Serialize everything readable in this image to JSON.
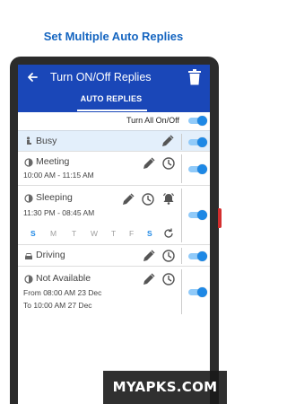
{
  "promo": {
    "title": "Set Multiple Auto Replies"
  },
  "appbar": {
    "title": "Turn ON/Off Replies"
  },
  "tabs": [
    {
      "label": "AUTO REPLIES"
    }
  ],
  "toggle_all": {
    "label": "Turn All On/Off",
    "on": true
  },
  "rows": [
    {
      "title": "Busy",
      "on": true,
      "selected": true
    },
    {
      "title": "Meeting",
      "time": "10:00 AM - 11:15 AM",
      "on": true
    },
    {
      "title": "Sleeping",
      "time": "11:30 PM - 08:45 AM",
      "on": true,
      "days": [
        "S",
        "M",
        "T",
        "W",
        "T",
        "F",
        "S"
      ],
      "days_on": [
        true,
        false,
        false,
        false,
        false,
        false,
        true
      ]
    },
    {
      "title": "Driving",
      "on": true
    },
    {
      "title": "Not Available",
      "from": "From 08:00 AM 23 Dec",
      "to": "To 10:00 AM 27 Dec",
      "on": true
    }
  ],
  "watermark": {
    "text": "MYAPKS.COM"
  },
  "colors": {
    "primary": "#1a47b8",
    "accent": "#1e88e5",
    "promo": "#1565c0"
  }
}
